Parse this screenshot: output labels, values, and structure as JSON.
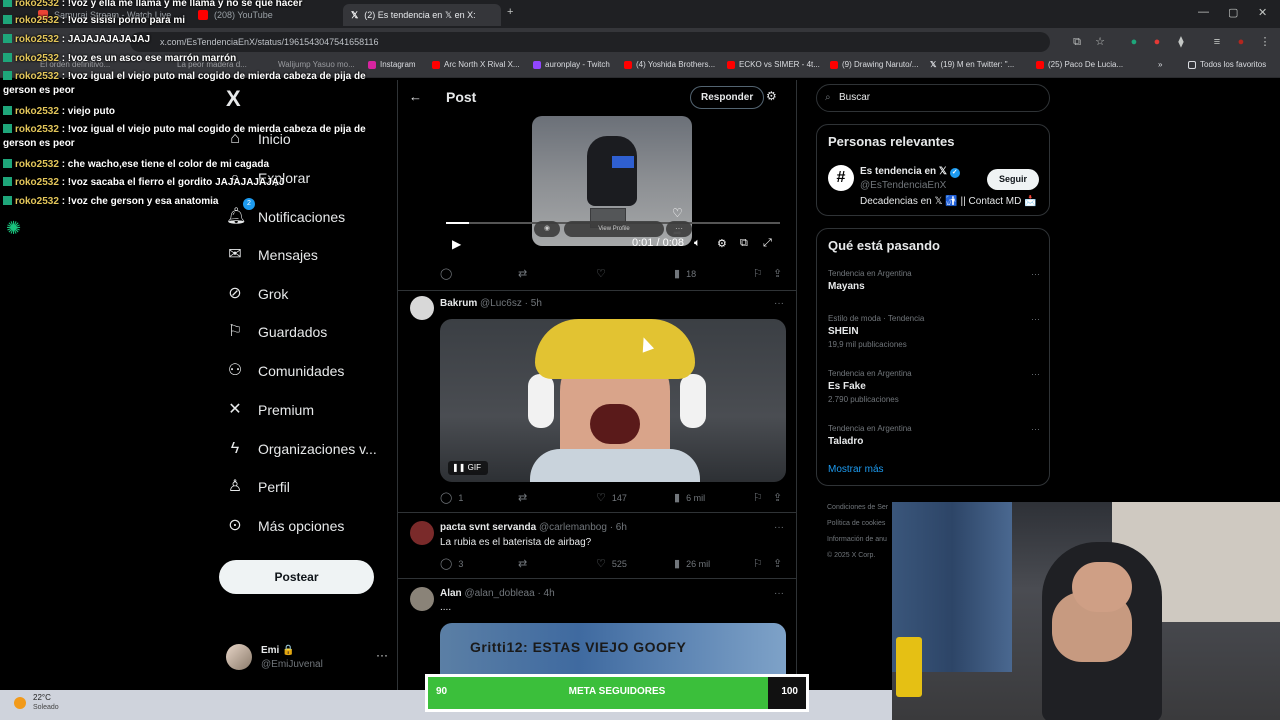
{
  "browser": {
    "tabs": [
      {
        "label": "Samurai Stream - Watch Live",
        "color": "#ea4335"
      },
      {
        "label": "(208) YouTube",
        "color": "#ff0000"
      },
      {
        "label": "(2) Es tendencia en 𝕏 en X:",
        "color": "#ffffff"
      }
    ],
    "url": "x.com/EsTendenciaEnX/status/1961543047541658116",
    "bookmarks_left": [
      "El orden definitivo...",
      "La peor madera d...",
      "Walijump Yasuo mo..."
    ],
    "bookmarks": [
      "Instagram",
      "Arc North X Rival X...",
      "auronplay - Twitch",
      "(4) Yoshida Brothers...",
      "ECKO vs SIMER - 4t...",
      "(9) Drawing Naruto/...",
      "(19) M en Twitter: \"...",
      "(25) Paco De Lucia..."
    ],
    "bookmarks_all": "Todos los favoritos"
  },
  "chat": {
    "messages": [
      {
        "user": "roko2532",
        "text": ": !voz y ella me llama y me llama y no se que hacer"
      },
      {
        "user": "roko2532",
        "text": ": !voz sisisi porno para mi"
      },
      {
        "user": "roko2532",
        "text": ": JAJAJAJAJAJAJ"
      },
      {
        "user": "roko2532",
        "text": ": !voz es un asco ese marrón marrón"
      },
      {
        "user": "roko2532",
        "text": ": !voz igual el viejo puto mal cogido de mierda cabeza de pija de gerson es peor"
      },
      {
        "user": "roko2532",
        "text": ": viejo puto"
      },
      {
        "user": "roko2532",
        "text": ": !voz igual el viejo puto mal cogido de mierda cabeza de pija de gerson es peor"
      },
      {
        "user": "roko2532",
        "text": ": che wacho,ese tiene el color de mi cagada"
      },
      {
        "user": "roko2532",
        "text": ": !voz sacaba el fierro el gordito JAJAJAJAJAJ"
      },
      {
        "user": "roko2532",
        "text": ": !voz che gerson y esa anatomia"
      }
    ]
  },
  "nav": {
    "logo": "X",
    "items": [
      {
        "label": "Inicio",
        "icon": "home-icon"
      },
      {
        "label": "Explorar",
        "icon": "search-icon"
      },
      {
        "label": "Notificaciones",
        "icon": "bell-icon",
        "badge": "2"
      },
      {
        "label": "Mensajes",
        "icon": "mail-icon"
      },
      {
        "label": "Grok",
        "icon": "grok-icon"
      },
      {
        "label": "Guardados",
        "icon": "bookmark-icon"
      },
      {
        "label": "Comunidades",
        "icon": "people-icon"
      },
      {
        "label": "Premium",
        "icon": "x-icon"
      },
      {
        "label": "Organizaciones v...",
        "icon": "lightning-icon"
      },
      {
        "label": "Perfil",
        "icon": "person-icon"
      },
      {
        "label": "Más opciones",
        "icon": "more-icon"
      }
    ],
    "post_button": "Postear",
    "account": {
      "name": "Emi 🔒",
      "handle": "@EmiJuvenal"
    }
  },
  "main": {
    "title": "Post",
    "reply_button": "Responder",
    "video": {
      "time": "0:01 / 0:08",
      "overlay_label": "View Profile",
      "progress": 0.07
    },
    "video_actions": {
      "reply": "",
      "retweet": "",
      "like": "",
      "views": "18"
    },
    "tweets": [
      {
        "name": "Bakrum",
        "handle": "@Luc6sz",
        "time": "· 5h",
        "gif_label": "GIF",
        "reply": "1",
        "retweet": "",
        "like": "147",
        "views": "6 mil"
      },
      {
        "name": "pacta svnt servanda",
        "handle": "@carlemanbog",
        "time": "· 6h",
        "text": "La rubia es el baterista de airbag?",
        "reply": "3",
        "retweet": "",
        "like": "525",
        "views": "26 mil"
      },
      {
        "name": "Alan",
        "handle": "@alan_dobleaa",
        "time": "· 4h",
        "text": "....",
        "image_text": "Gritti12: ESTAS VIEJO GOOFY"
      }
    ]
  },
  "right": {
    "search_placeholder": "Buscar",
    "relevant_title": "Personas relevantes",
    "relevant": {
      "name": "Es tendencia en 𝕏",
      "handle": "@EsTendenciaEnX",
      "bio": "Decadencias en 𝕏 🚮 || Contact MD 📩",
      "follow": "Seguir"
    },
    "trending_title": "Qué está pasando",
    "trends": [
      {
        "context": "Tendencia en Argentina",
        "title": "Mayans",
        "count": ""
      },
      {
        "context": "Estilo de moda · Tendencia",
        "title": "SHEIN",
        "count": "19,9 mil publicaciones"
      },
      {
        "context": "Tendencia en Argentina",
        "title": "Es Fake",
        "count": "2.790 publicaciones"
      },
      {
        "context": "Tendencia en Argentina",
        "title": "Taladro",
        "count": ""
      }
    ],
    "show_more": "Mostrar más",
    "footer": [
      "Condiciones de Ser",
      "Política de cookies",
      "Información de anu",
      "© 2025 X Corp."
    ]
  },
  "taskbar": {
    "temp": "22°C",
    "weather": "Soleado"
  },
  "goal": {
    "min": "90",
    "label": "META SEGUIDORES",
    "max": "100",
    "progress": 0.9
  }
}
